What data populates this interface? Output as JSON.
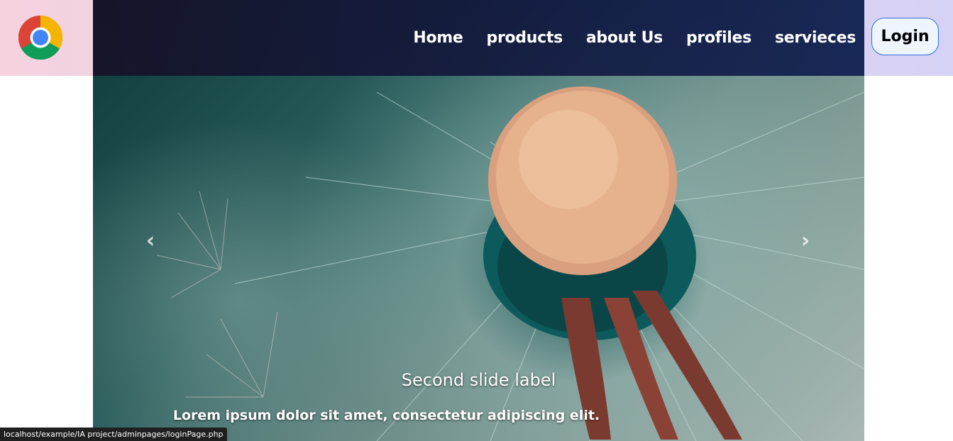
{
  "header": {
    "logo_icon": "chrome-icon"
  },
  "nav": {
    "items": [
      {
        "label": "Home"
      },
      {
        "label": "products"
      },
      {
        "label": "about Us"
      },
      {
        "label": "profiles"
      },
      {
        "label": "servieces"
      }
    ],
    "login_label": "Login"
  },
  "carousel": {
    "prev_icon": "chevron-left-icon",
    "next_icon": "chevron-right-icon",
    "prev_glyph": "‹",
    "next_glyph": "›",
    "caption_title": "Second slide label",
    "caption_text": "Lorem ipsum dolor sit amet, consectetur adipiscing elit."
  },
  "status_bar": {
    "url": "localhost/example/IA project/adminpages/loginPage.php"
  },
  "colors": {
    "navbar": "#161228",
    "login_border": "#2f6fd6",
    "login_bg": "#eef5ff"
  }
}
